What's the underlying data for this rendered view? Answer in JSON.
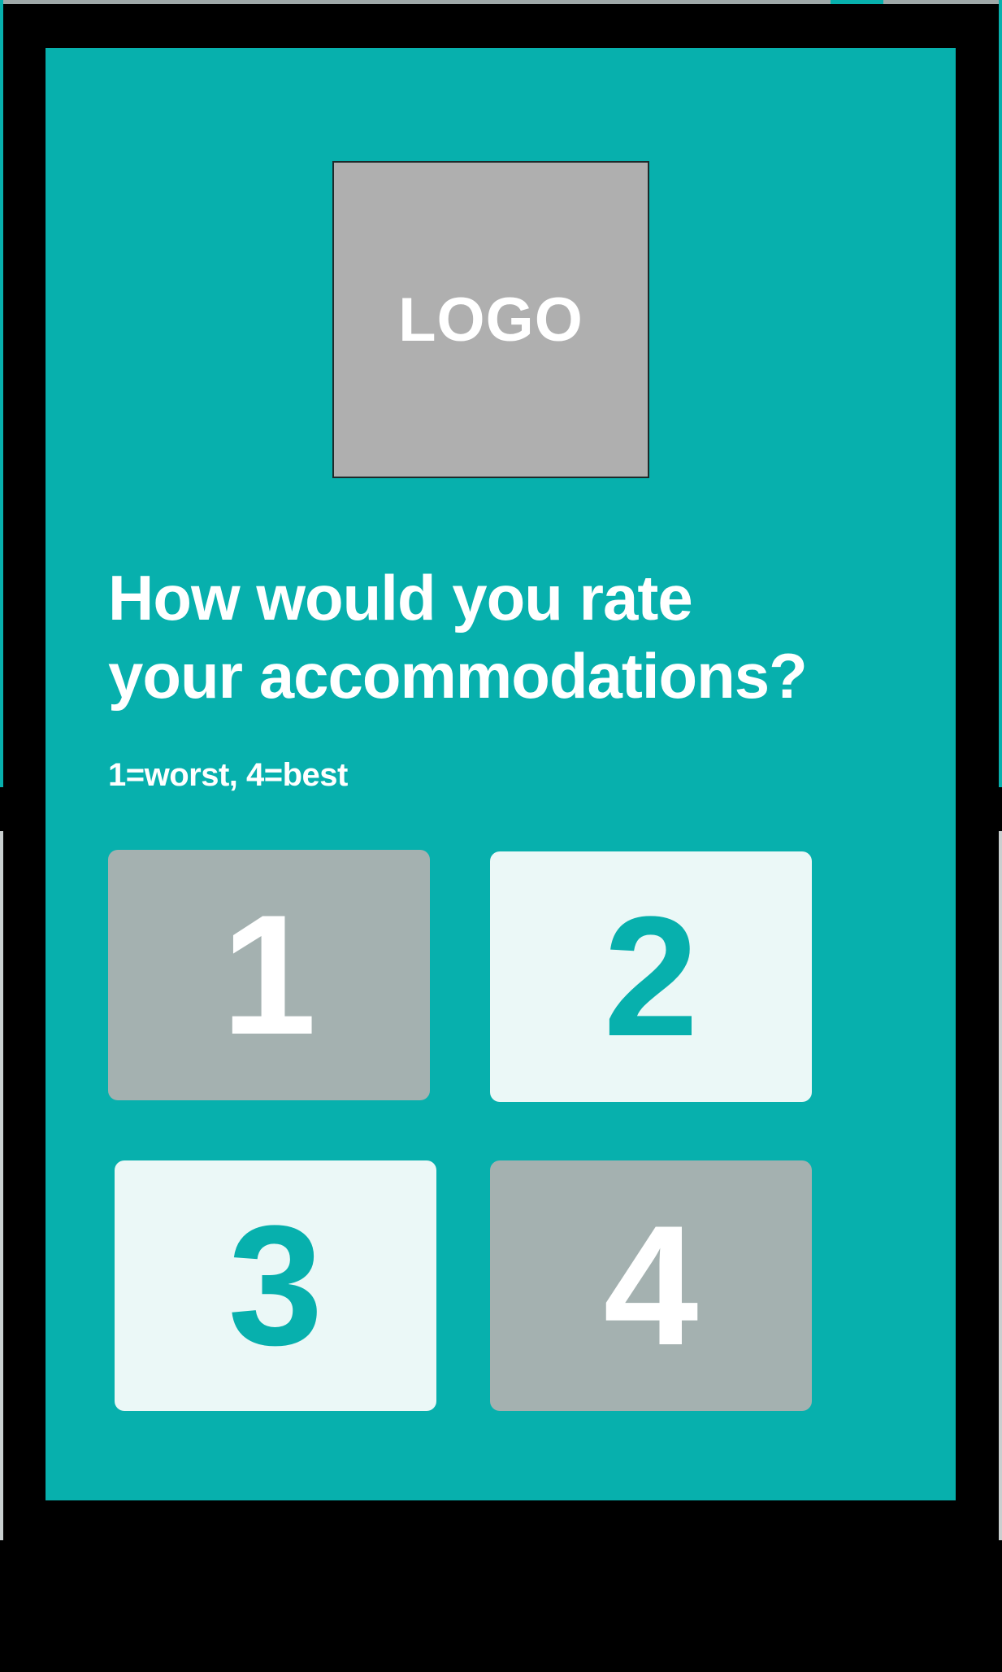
{
  "logo": {
    "text": "LOGO"
  },
  "survey": {
    "question_line1": "How would you rate",
    "question_line2": "your accommodations?",
    "scale_hint": "1=worst, 4=best"
  },
  "ratings": [
    {
      "label": "1"
    },
    {
      "label": "2"
    },
    {
      "label": "3"
    },
    {
      "label": "4"
    }
  ],
  "colors": {
    "screen_background": "#07b0ad",
    "frame": "#000000",
    "logo_placeholder": "#afafaf",
    "rating_grey": "#a4b1b0",
    "rating_light": "#ebf8f7",
    "text_primary": "#ffffff"
  }
}
